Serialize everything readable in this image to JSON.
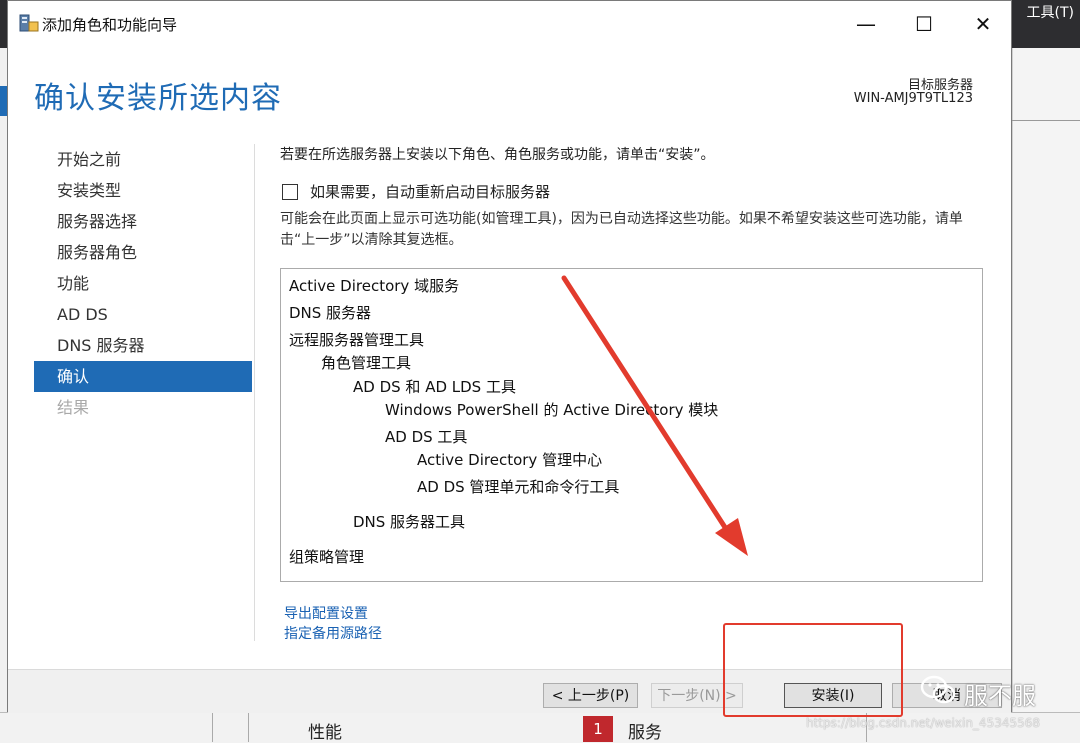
{
  "background": {
    "tools_menu": "工具(T)",
    "perf_label": "性能",
    "service_count": "1",
    "service_label": "服务"
  },
  "window": {
    "title": "添加角色和功能向导",
    "controls": [
      "—",
      "☐",
      "✕"
    ]
  },
  "header": {
    "page_title": "确认安装所选内容",
    "target_label": "目标服务器",
    "target_name": "WIN-AMJ9T9TL123"
  },
  "nav": {
    "items": [
      {
        "label": "开始之前",
        "state": "normal"
      },
      {
        "label": "安装类型",
        "state": "normal"
      },
      {
        "label": "服务器选择",
        "state": "normal"
      },
      {
        "label": "服务器角色",
        "state": "normal"
      },
      {
        "label": "功能",
        "state": "normal"
      },
      {
        "label": "AD DS",
        "state": "normal"
      },
      {
        "label": "DNS 服务器",
        "state": "normal"
      },
      {
        "label": "确认",
        "state": "active"
      },
      {
        "label": "结果",
        "state": "disabled"
      }
    ]
  },
  "content": {
    "intro": "若要在所选服务器上安装以下角色、角色服务或功能，请单击“安装”。",
    "restart_label": "如果需要，自动重新启动目标服务器",
    "restart_checked": false,
    "note": "可能会在此页面上显示可选功能(如管理工具)，因为已自动选择这些功能。如果不希望安装这些可选功能，请单击“上一步”以清除其复选框。",
    "features": [
      {
        "label": "Active Directory 域服务",
        "level": 0
      },
      {
        "label": "DNS 服务器",
        "level": 0
      },
      {
        "label": "远程服务器管理工具",
        "level": 0
      },
      {
        "label": "角色管理工具",
        "level": 1
      },
      {
        "label": "AD DS 和 AD LDS 工具",
        "level": 2
      },
      {
        "label": "Windows PowerShell 的 Active Directory 模块",
        "level": 3
      },
      {
        "label": "AD DS 工具",
        "level": 3
      },
      {
        "label": "Active Directory 管理中心",
        "level": 4
      },
      {
        "label": "AD DS 管理单元和命令行工具",
        "level": 4
      },
      {
        "label": "DNS 服务器工具",
        "level": 2
      },
      {
        "label": "组策略管理",
        "level": 0
      }
    ],
    "export_link": "导出配置设置",
    "alt_source_link": "指定备用源路径"
  },
  "footer": {
    "prev": "< 上一步(P)",
    "next": "下一步(N) >",
    "install": "安装(I)",
    "cancel": "取消"
  },
  "watermark": {
    "name": "服不服",
    "url": "https://blog.csdn.net/weixin_45345568"
  },
  "colors": {
    "accent": "#1f6bb5",
    "annotation": "#e23b2d",
    "link": "#1a62b3"
  }
}
